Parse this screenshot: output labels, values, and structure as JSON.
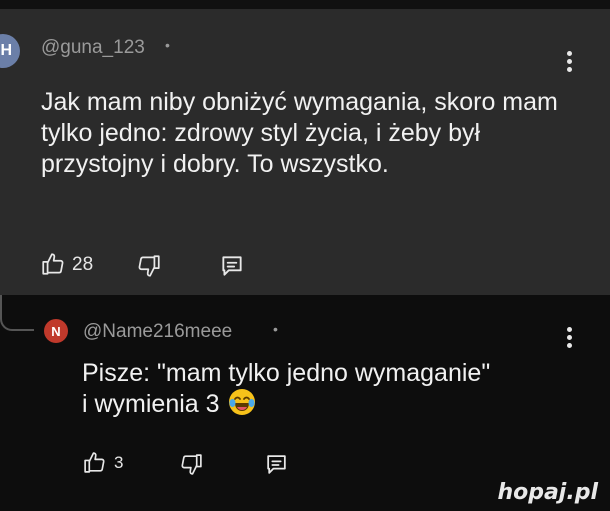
{
  "colors": {
    "top_comment_bg": "#2b2b2b",
    "reply_bg": "#0d0d0d",
    "text": "#f1f1f1",
    "muted_text": "#9a9a9a",
    "avatar1_bg": "#6b7fa8",
    "avatar2_bg": "#c0392b"
  },
  "comment": {
    "avatar_letter": "H",
    "author": "@guna_123",
    "separator": "•",
    "text": "Jak mam niby obniżyć wymagania, skoro mam tylko jedno: zdrowy styl życia, i żeby był przystojny i dobry. To wszystko.",
    "likes": "28",
    "icons": [
      "thumbs-up-icon",
      "thumbs-down-icon",
      "reply-icon",
      "more-vert-icon"
    ]
  },
  "reply": {
    "avatar_letter": "N",
    "author": "@Name216meee",
    "separator": "•",
    "text_line1": "Pisze: \"mam tylko jedno wymaganie\"",
    "text_line2": "i wymienia 3",
    "emoji": "laughing-tears-emoji",
    "likes": "3",
    "icons": [
      "thumbs-up-icon",
      "thumbs-down-icon",
      "reply-icon",
      "more-vert-icon"
    ]
  },
  "watermark": {
    "text": "hopaj.pl"
  }
}
